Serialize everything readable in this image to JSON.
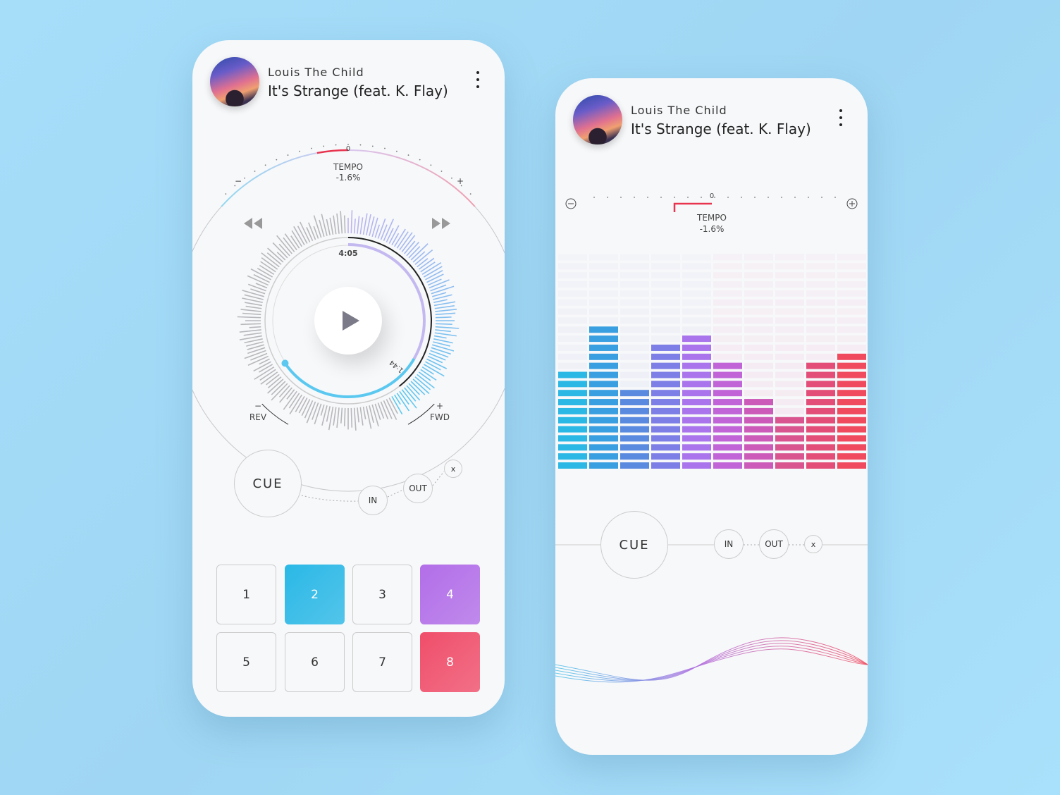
{
  "track": {
    "artist": "Louis The Child",
    "title": "It's Strange (feat. K. Flay)"
  },
  "left": {
    "tempo": {
      "label": "TEMPO",
      "value": "-1.6%",
      "zero": "0",
      "minus": "−",
      "plus": "+"
    },
    "time_total": "4:05",
    "time_elapsed": "1:44",
    "progress_fraction": 0.42,
    "rev": {
      "sign": "−",
      "label": "REV"
    },
    "fwd": {
      "sign": "+",
      "label": "FWD"
    },
    "cue": "CUE",
    "in": "IN",
    "out": "OUT",
    "clear": "x",
    "pads": [
      {
        "label": "1"
      },
      {
        "label": "2",
        "active": true,
        "color": "#2ab8e6"
      },
      {
        "label": "3"
      },
      {
        "label": "4",
        "active": true,
        "color": "#b26ee8"
      },
      {
        "label": "5"
      },
      {
        "label": "6"
      },
      {
        "label": "7"
      },
      {
        "label": "8",
        "active": true,
        "color": "#f04e6a"
      }
    ]
  },
  "right": {
    "tempo": {
      "label": "TEMPO",
      "value": "-1.6%",
      "zero": "0"
    },
    "equalizer": {
      "rows": 24,
      "levels": [
        11,
        16,
        9,
        14,
        15,
        12,
        8,
        6,
        12,
        13
      ],
      "colors": [
        "#2bb8e4",
        "#3a9fe0",
        "#5a8ae0",
        "#7d7ee6",
        "#a974ec",
        "#c064d8",
        "#cc5ab8",
        "#d8558f",
        "#e34e78",
        "#f04a5e"
      ]
    },
    "cue": "CUE",
    "in": "IN",
    "out": "OUT",
    "clear": "x"
  },
  "colors": {
    "accent_blue": "#5bc8f0",
    "accent_red": "#e8344e",
    "accent_purple": "#b9a6f0"
  }
}
